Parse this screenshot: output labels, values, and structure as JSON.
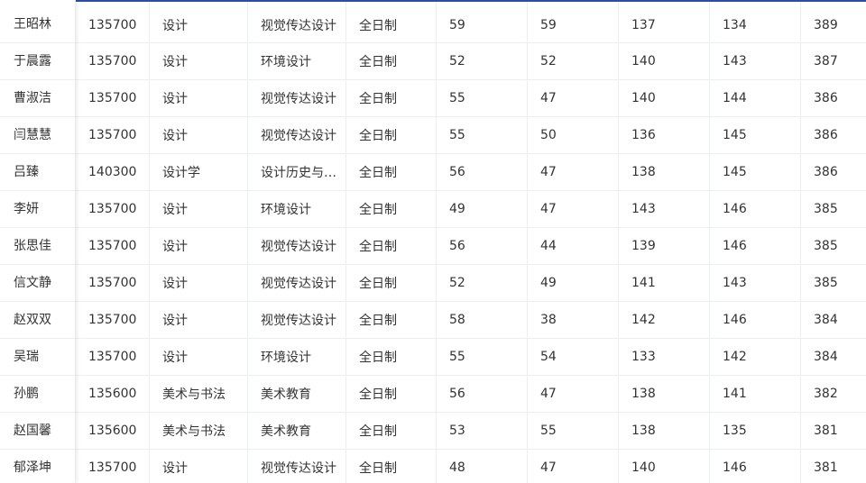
{
  "table": {
    "rows": [
      {
        "name": "王昭林",
        "code": "135700",
        "category": "设计",
        "major": "视觉传达设计",
        "mode": "全日制",
        "s1": "59",
        "s2": "59",
        "s3": "137",
        "s4": "134",
        "total": "389"
      },
      {
        "name": "于晨露",
        "code": "135700",
        "category": "设计",
        "major": "环境设计",
        "mode": "全日制",
        "s1": "52",
        "s2": "52",
        "s3": "140",
        "s4": "143",
        "total": "387"
      },
      {
        "name": "曹淑洁",
        "code": "135700",
        "category": "设计",
        "major": "视觉传达设计",
        "mode": "全日制",
        "s1": "55",
        "s2": "47",
        "s3": "140",
        "s4": "144",
        "total": "386"
      },
      {
        "name": "闫慧慧",
        "code": "135700",
        "category": "设计",
        "major": "视觉传达设计",
        "mode": "全日制",
        "s1": "55",
        "s2": "50",
        "s3": "136",
        "s4": "145",
        "total": "386"
      },
      {
        "name": "吕臻",
        "code": "140300",
        "category": "设计学",
        "major": "设计历史与…",
        "mode": "全日制",
        "s1": "56",
        "s2": "47",
        "s3": "138",
        "s4": "145",
        "total": "386"
      },
      {
        "name": "李妍",
        "code": "135700",
        "category": "设计",
        "major": "环境设计",
        "mode": "全日制",
        "s1": "49",
        "s2": "47",
        "s3": "143",
        "s4": "146",
        "total": "385"
      },
      {
        "name": "张思佳",
        "code": "135700",
        "category": "设计",
        "major": "视觉传达设计",
        "mode": "全日制",
        "s1": "56",
        "s2": "44",
        "s3": "139",
        "s4": "146",
        "total": "385"
      },
      {
        "name": "信文静",
        "code": "135700",
        "category": "设计",
        "major": "视觉传达设计",
        "mode": "全日制",
        "s1": "52",
        "s2": "49",
        "s3": "141",
        "s4": "143",
        "total": "385"
      },
      {
        "name": "赵双双",
        "code": "135700",
        "category": "设计",
        "major": "视觉传达设计",
        "mode": "全日制",
        "s1": "58",
        "s2": "38",
        "s3": "142",
        "s4": "146",
        "total": "384"
      },
      {
        "name": "吴瑞",
        "code": "135700",
        "category": "设计",
        "major": "环境设计",
        "mode": "全日制",
        "s1": "55",
        "s2": "54",
        "s3": "133",
        "s4": "142",
        "total": "384"
      },
      {
        "name": "孙鹏",
        "code": "135600",
        "category": "美术与书法",
        "major": "美术教育",
        "mode": "全日制",
        "s1": "56",
        "s2": "47",
        "s3": "138",
        "s4": "141",
        "total": "382"
      },
      {
        "name": "赵国馨",
        "code": "135600",
        "category": "美术与书法",
        "major": "美术教育",
        "mode": "全日制",
        "s1": "53",
        "s2": "55",
        "s3": "138",
        "s4": "135",
        "total": "381"
      },
      {
        "name": "郁泽坤",
        "code": "135700",
        "category": "设计",
        "major": "视觉传达设计",
        "mode": "全日制",
        "s1": "48",
        "s2": "47",
        "s3": "140",
        "s4": "146",
        "total": "381"
      }
    ]
  },
  "colors": {
    "header_accent": "#2b4f9c",
    "row_border": "#ebeef5",
    "text": "#333333"
  }
}
